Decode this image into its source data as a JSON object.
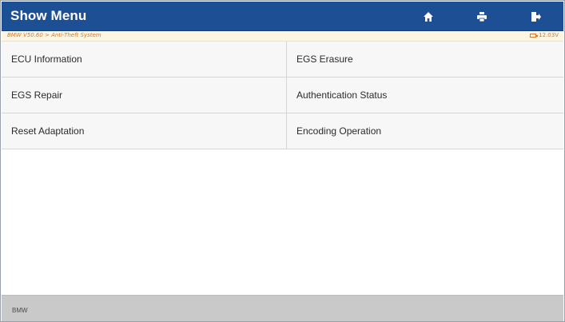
{
  "header": {
    "title": "Show Menu",
    "icons": [
      "home-icon",
      "print-icon",
      "exit-icon"
    ],
    "background_color": "#1c4f94"
  },
  "subheader": {
    "breadcrumb": "BMW V50.60 > Anti-Theft System",
    "battery_voltage": "12.03V",
    "text_color": "#e0772a"
  },
  "menu": {
    "items": [
      {
        "label": "ECU Information"
      },
      {
        "label": "EGS Erasure"
      },
      {
        "label": "EGS Repair"
      },
      {
        "label": "Authentication Status"
      },
      {
        "label": "Reset Adaptation"
      },
      {
        "label": "Encoding Operation"
      }
    ]
  },
  "footer": {
    "label": "BMW"
  }
}
